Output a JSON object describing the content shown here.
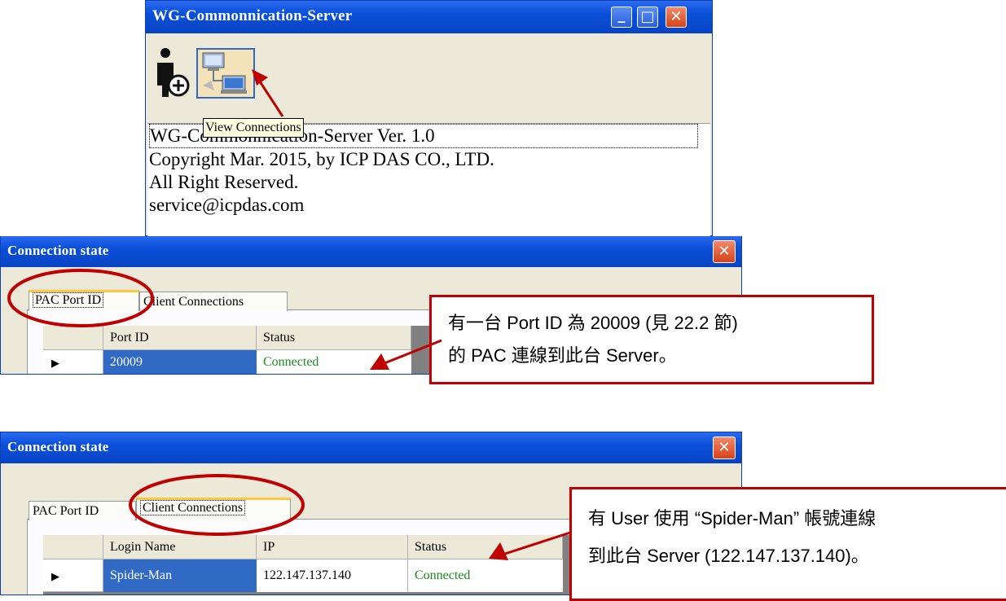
{
  "main_window": {
    "title": "WG-Commonnication-Server",
    "minimize_glyph": "_",
    "maximize_glyph": "□",
    "close_glyph": "✕",
    "toolbar": {
      "add_user_icon": "add-user-icon",
      "view_connections_icon": "network-computers-icon",
      "tooltip": "View Connections"
    },
    "info_lines": [
      "WG-Commonnication-Server Ver. 1.0",
      "Copyright Mar. 2015, by ICP DAS CO., LTD.",
      "All Right Reserved.",
      "service@icpdas.com"
    ]
  },
  "connection_window_1": {
    "title": "Connection state",
    "close_glyph": "✕",
    "tabs": [
      "PAC Port ID",
      "Client Connections"
    ],
    "active_tab": "PAC Port ID",
    "columns": [
      "Port ID",
      "Status"
    ],
    "rows": [
      {
        "marker": "▶",
        "port_id": "20009",
        "status": "Connected"
      }
    ]
  },
  "callout_1": {
    "line1": "有一台 Port ID 為 20009 (見 22.2 節)",
    "line2": "的 PAC 連線到此台 Server。"
  },
  "connection_window_2": {
    "title": "Connection state",
    "close_glyph": "✕",
    "tabs": [
      "PAC Port ID",
      "Client Connections"
    ],
    "active_tab": "Client Connections",
    "columns": [
      "Login Name",
      "IP",
      "Status"
    ],
    "rows": [
      {
        "marker": "▶",
        "login_name": "Spider-Man",
        "ip": "122.147.137.140",
        "status": "Connected"
      }
    ]
  },
  "callout_2": {
    "line1": "有 User 使用 “Spider-Man” 帳號連線",
    "line2": "到此台 Server (122.147.137.140)。"
  },
  "colors": {
    "titlebar_blue": "#0a4fd8",
    "highlight_red": "#c00000",
    "selection_blue": "#316ac5",
    "connected_green": "#1c8a1c"
  }
}
